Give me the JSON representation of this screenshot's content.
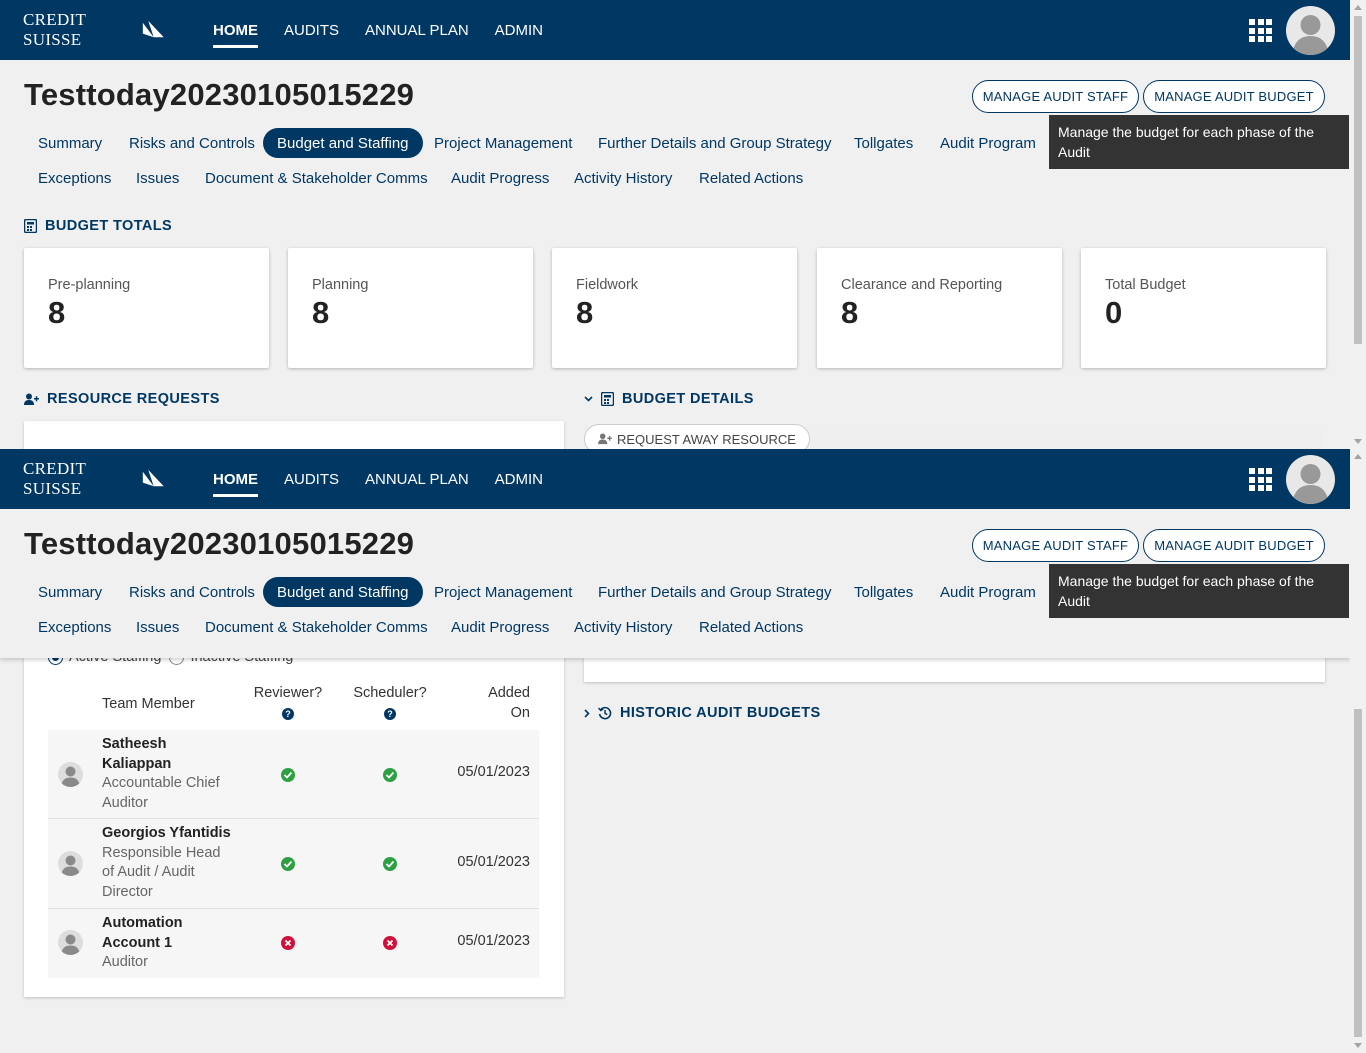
{
  "brand": {
    "name": "CREDIT SUISSE"
  },
  "nav": {
    "items": [
      {
        "label": "HOME",
        "active": true
      },
      {
        "label": "AUDITS"
      },
      {
        "label": "ANNUAL PLAN"
      },
      {
        "label": "ADMIN"
      }
    ]
  },
  "page": {
    "title": "Testtoday20230105015229",
    "manage_staff_label": "MANAGE AUDIT STAFF",
    "manage_budget_label": "MANAGE AUDIT BUDGET",
    "tooltip": "Manage the budget for each phase of the Audit"
  },
  "tabs": {
    "summary": "Summary",
    "risks": "Risks and Controls",
    "budget": "Budget and Staffing",
    "project": "Project Management",
    "further": "Further Details and Group Strategy",
    "tollgates": "Tollgates",
    "program": "Audit Program",
    "exceptions": "Exceptions",
    "issues": "Issues",
    "docs": "Document & Stakeholder Comms",
    "progress": "Audit Progress",
    "activity": "Activity History",
    "related": "Related Actions"
  },
  "budget_totals": {
    "heading": "BUDGET TOTALS",
    "cards": [
      {
        "label": "Pre-planning",
        "value": "8"
      },
      {
        "label": "Planning",
        "value": "8"
      },
      {
        "label": "Fieldwork",
        "value": "8"
      },
      {
        "label": "Clearance and Reporting",
        "value": "8"
      },
      {
        "label": "Total Budget",
        "value": "0"
      }
    ]
  },
  "resource_requests": {
    "heading": "RESOURCE REQUESTS"
  },
  "budget_details": {
    "heading": "BUDGET DETAILS",
    "request_away_label": "REQUEST AWAY RESOURCE"
  },
  "historic": {
    "heading": "HISTORIC AUDIT BUDGETS"
  },
  "staffing": {
    "active_label": "Active Staffing",
    "inactive_label": "Inactive Staffing",
    "columns": {
      "member": "Team Member",
      "reviewer": "Reviewer?",
      "scheduler": "Scheduler?",
      "added_1": "Added",
      "added_2": "On"
    },
    "rows": [
      {
        "name_1": "Satheesh",
        "name_2": "Kaliappan",
        "role_1": "Accountable Chief",
        "role_2": "Auditor",
        "reviewer": true,
        "scheduler": true,
        "date": "05/01/2023"
      },
      {
        "name_1": "Georgios Yfantidis",
        "role_1": "Responsible Head",
        "role_2": "of Audit / Audit",
        "role_3": "Director",
        "reviewer": true,
        "scheduler": true,
        "date": "05/01/2023"
      },
      {
        "name_1": "Automation",
        "name_2": "Account 1",
        "role_1": "Auditor",
        "reviewer": false,
        "scheduler": false,
        "date": "05/01/2023"
      }
    ]
  },
  "colors": {
    "brand": "#003763",
    "ok": "#2ea043",
    "err": "#d0103a"
  }
}
